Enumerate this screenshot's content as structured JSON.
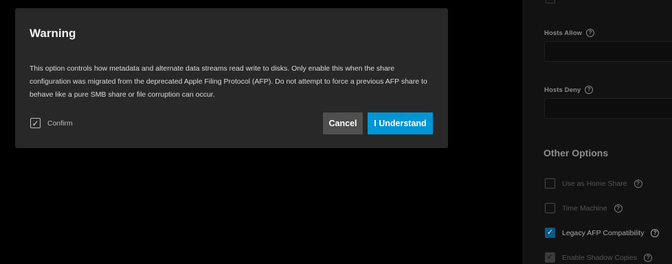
{
  "dialog": {
    "title": "Warning",
    "message": "This option controls how metadata and alternate data streams read write to disks. Only enable this when the share configuration was migrated from the deprecated Apple Filing Protocol (AFP). Do not attempt to force a previous AFP share to behave like a pure SMB share or file corruption can occur.",
    "confirm_label": "Confirm",
    "confirm_checked": true,
    "cancel_label": "Cancel",
    "ok_label": "I Understand"
  },
  "form": {
    "hosts_allow_label": "Hosts Allow",
    "hosts_deny_label": "Hosts Deny",
    "help_glyph": "?",
    "other_options_title": "Other Options",
    "options": [
      {
        "label": "Use as Home Share",
        "checked": false
      },
      {
        "label": "Time Machine",
        "checked": false
      },
      {
        "label": "Legacy AFP Compatibility",
        "checked": true
      },
      {
        "label": "Enable Shadow Copies",
        "checked": true
      }
    ]
  },
  "colors": {
    "accent": "#0095d5",
    "dialog_bg": "#282828",
    "cancel_bg": "#4f4f4f",
    "checkbox_checked": "#0b5a82"
  },
  "icons": {
    "checkmark": "check-icon",
    "help": "help-circle-icon"
  }
}
